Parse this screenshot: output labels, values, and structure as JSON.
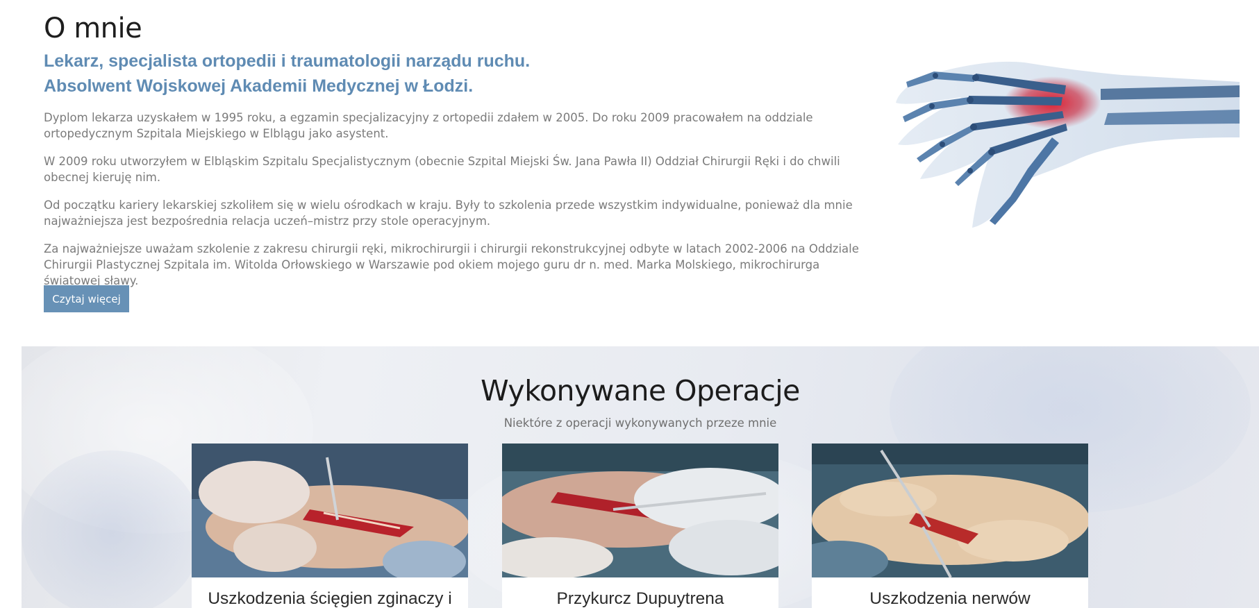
{
  "about": {
    "title": "O mnie",
    "subtitle_1": "Lekarz, specjalista ortopedii i traumatologii narządu ruchu.",
    "subtitle_2": "Absolwent Wojskowej Akademii Medycznej w Łodzi.",
    "paragraphs": [
      "Dyplom lekarza uzyskałem w 1995 roku, a egzamin specjalizacyjny z ortopedii zdałem w 2005. Do roku 2009 pracowałem na oddziale ortopedycznym Szpitala Miejskiego w Elblągu jako asystent.",
      "W 2009 roku utworzyłem w Elbląskim Szpitalu Specjalistycznym (obecnie Szpital Miejski Św. Jana Pawła II) Oddział Chirurgii Ręki i do chwili obecnej kieruję nim.",
      "Od początku kariery lekarskiej szkoliłem się w wielu ośrodkach w kraju. Były to szkolenia przede wszystkim indywidualne, ponieważ dla mnie najważniejsza jest bezpośrednia relacja uczeń–mistrz przy stole operacyjnym.",
      "Za najważniejsze uważam szkolenie z zakresu chirurgii ręki, mikrochirurgii i chirurgii rekonstrukcyjnej odbyte w latach 2002-2006 na Oddziale Chirurgii Plastycznej Szpitala im. Witolda Orłowskiego w Warszawie pod okiem mojego guru dr n. med. Marka Molskiego, mikrochirurga światowej sławy."
    ],
    "read_more_label": "Czytaj więcej"
  },
  "operations": {
    "title": "Wykonywane Operacje",
    "subtitle": "Niektóre z operacji wykonywanych przeze mnie",
    "cards": [
      {
        "title": "Uszkodzenia ścięgien zginaczy i"
      },
      {
        "title": "Przykurcz Dupuytrena"
      },
      {
        "title": "Uszkodzenia nerwów"
      }
    ]
  },
  "colors": {
    "accent": "#6791b6",
    "subtitle_blue": "#5f8bb3",
    "body_text": "#7b7b7b"
  },
  "icons": {
    "hero_image": "hand-xray-image",
    "card_images": [
      "surgery-photo-tendon",
      "surgery-photo-dupuytren",
      "surgery-photo-nerve"
    ]
  }
}
